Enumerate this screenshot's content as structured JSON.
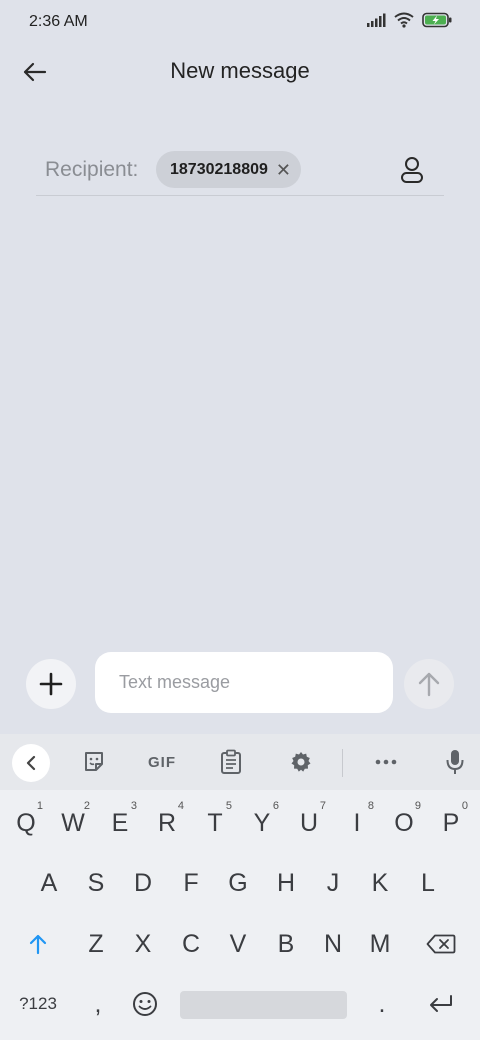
{
  "status_bar": {
    "time": "2:36 AM",
    "battery_color": "#4caf50"
  },
  "header": {
    "title": "New message",
    "back_icon": "arrow-left-icon"
  },
  "recipient": {
    "label": "Recipient:",
    "chip_value": "18730218809",
    "chip_remove_icon": "close-icon",
    "contacts_icon": "person-icon"
  },
  "compose": {
    "attach_icon": "plus-icon",
    "placeholder": "Text message",
    "send_icon": "arrow-up-icon"
  },
  "keyboard": {
    "toolbar": {
      "gif_label": "GIF"
    },
    "row1": [
      {
        "key": "Q",
        "num": "1"
      },
      {
        "key": "W",
        "num": "2"
      },
      {
        "key": "E",
        "num": "3"
      },
      {
        "key": "R",
        "num": "4"
      },
      {
        "key": "T",
        "num": "5"
      },
      {
        "key": "Y",
        "num": "6"
      },
      {
        "key": "U",
        "num": "7"
      },
      {
        "key": "I",
        "num": "8"
      },
      {
        "key": "O",
        "num": "9"
      },
      {
        "key": "P",
        "num": "0"
      }
    ],
    "row2": [
      "A",
      "S",
      "D",
      "F",
      "G",
      "H",
      "J",
      "K",
      "L"
    ],
    "row3": [
      "Z",
      "X",
      "C",
      "V",
      "B",
      "N",
      "M"
    ],
    "row4": {
      "symbols_label": "?123",
      "comma_label": ",",
      "period_label": "."
    }
  }
}
